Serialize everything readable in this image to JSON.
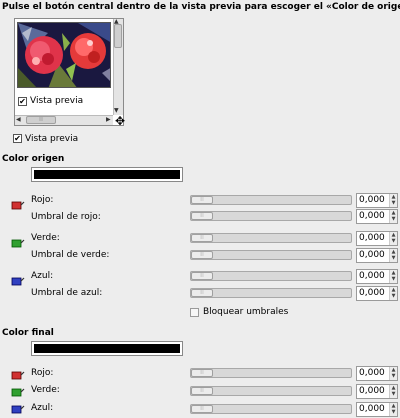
{
  "header": {
    "instruction": "Pulse el botón central dentro de la vista previa para escoger el «Color de origen»"
  },
  "preview": {
    "inner_checkbox_label": "Vista previa",
    "inner_checkbox_checked": true,
    "outer_checkbox_label": "Vista previa",
    "outer_checkbox_checked": true
  },
  "color_origen": {
    "title": "Color origen",
    "swatch_color": "#000000",
    "rows": [
      {
        "label": "Rojo:",
        "value": "0,000",
        "icon_color": "#d03030"
      },
      {
        "label": "Umbral de rojo:",
        "value": "0,000"
      },
      {
        "label": "Verde:",
        "value": "0,000",
        "icon_color": "#30a030"
      },
      {
        "label": "Umbral de verde:",
        "value": "0,000"
      },
      {
        "label": "Azul:",
        "value": "0,000",
        "icon_color": "#3040c0"
      },
      {
        "label": "Umbral de azul:",
        "value": "0,000"
      }
    ],
    "lock_label": "Bloquear umbrales",
    "lock_checked": false
  },
  "color_final": {
    "title": "Color final",
    "swatch_color": "#000000",
    "rows": [
      {
        "label": "Rojo:",
        "value": "0,000",
        "icon_color": "#d03030"
      },
      {
        "label": "Verde:",
        "value": "0,000",
        "icon_color": "#30a030"
      },
      {
        "label": "Azul:",
        "value": "0,000",
        "icon_color": "#3040c0"
      }
    ]
  },
  "icons": {
    "picker": "color-picker-icon",
    "navigate": "move-navigation-icon",
    "spin_up": "▲",
    "spin_down": "▼",
    "check": "✔"
  }
}
